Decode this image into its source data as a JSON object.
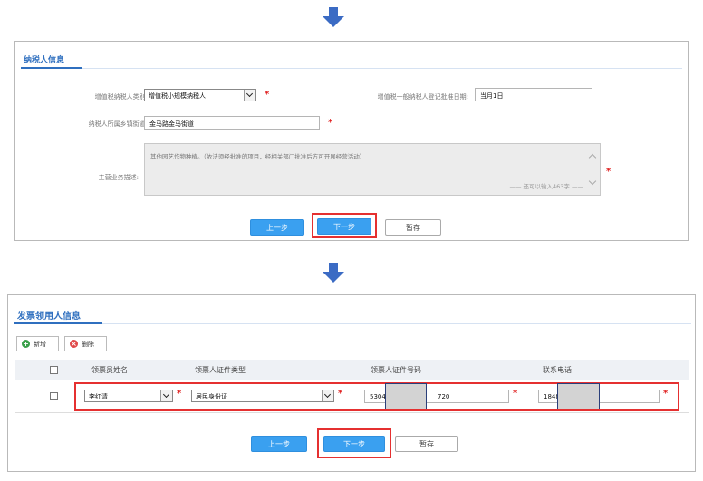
{
  "colors": {
    "accent": "#2f6fbf",
    "button_primary": "#3aa0f0",
    "required": "#e02020",
    "highlight": "#e53030"
  },
  "flow_arrows": [
    "arrow-down-icon",
    "arrow-down-icon"
  ],
  "taxpayer": {
    "title": "纳税人信息",
    "vat_category_label": "增值税纳税人类别:",
    "vat_category_value": "增值税小规模纳税人",
    "vat_reg_date_label": "增值税一般纳税人登记批准日期:",
    "vat_reg_date_value": "当月1日",
    "street_label": "纳税人所属乡镇街道:",
    "street_value": "金马路金马街道",
    "business_label": "主营业务描述:",
    "business_value": "其他园艺作物种植。（依法须经批准的项目，经相关部门批准后方可开展经营活动）",
    "char_counter": "—— 还可以输入463字 ——",
    "required_mark": "*",
    "buttons": {
      "prev": "上一步",
      "next": "下一步",
      "save": "暂存"
    }
  },
  "invoice": {
    "title": "发票领用人信息",
    "toolbar": {
      "add": "新增",
      "delete": "删除"
    },
    "columns": [
      "领票员姓名",
      "领票人证件类型",
      "领票人证件号码",
      "联系电话"
    ],
    "row": {
      "name": "李红清",
      "id_type": "居民身份证",
      "id_number_prefix": "5304",
      "id_number_suffix": "720",
      "phone_prefix": "1848"
    },
    "required_mark": "*",
    "buttons": {
      "prev": "上一步",
      "next": "下一步",
      "save": "暂存"
    }
  }
}
